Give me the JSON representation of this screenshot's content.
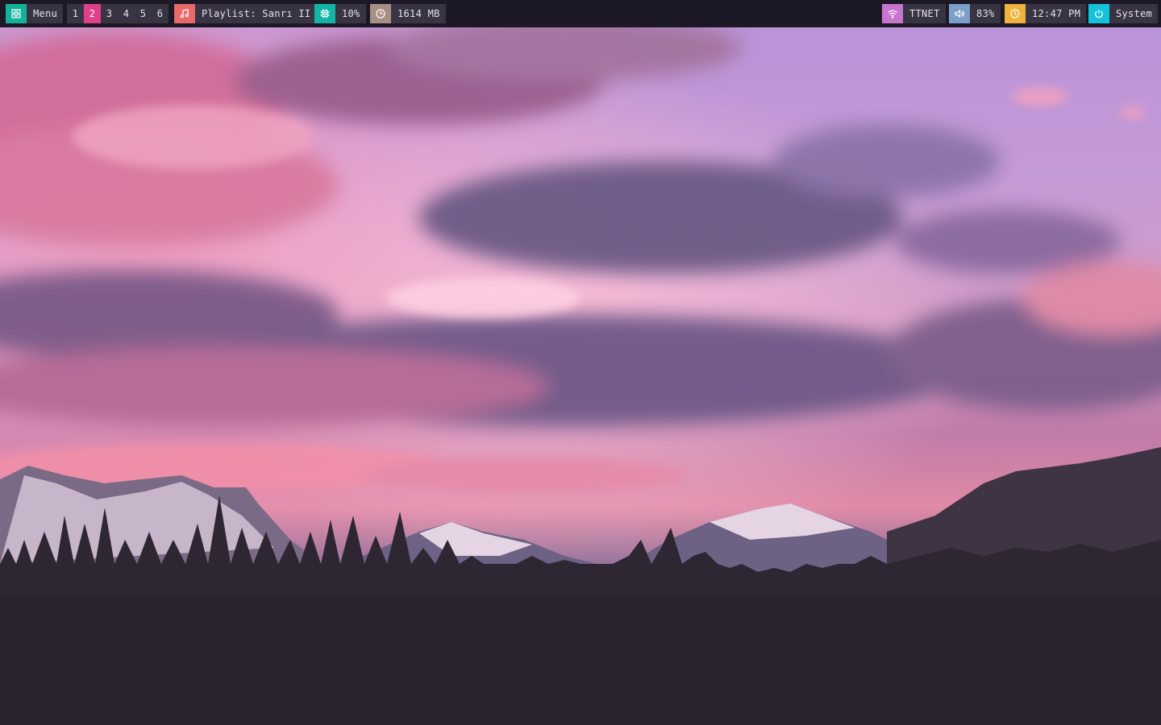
{
  "bar": {
    "menu": {
      "label": "Menu",
      "icon": "grid-icon",
      "color": "#15b29a"
    },
    "workspaces": {
      "items": [
        "1",
        "2",
        "3",
        "4",
        "5",
        "6"
      ],
      "active": "2",
      "active_color": "#e0408a"
    },
    "music": {
      "label": "Playlist: Sanrı II",
      "icon": "music-note-icon",
      "color": "#e86a6a"
    },
    "cpu": {
      "label": "10%",
      "icon": "cpu-chip-icon",
      "color": "#12b5a5"
    },
    "memory": {
      "label": "1614 MB",
      "icon": "clock-gauge-icon",
      "color": "#a88f84"
    },
    "network": {
      "label": "TTNET",
      "icon": "wifi-icon",
      "color": "#c776cf"
    },
    "volume": {
      "label": "83%",
      "icon": "speaker-icon",
      "color": "#7c9fc9"
    },
    "clock": {
      "label": "12:47 PM",
      "icon": "clock-icon",
      "color": "#f0b23a"
    },
    "system": {
      "label": "System",
      "icon": "power-icon",
      "color": "#14c2db"
    }
  },
  "wallpaper": {
    "description_icon": "mountain-sunset-wallpaper"
  }
}
